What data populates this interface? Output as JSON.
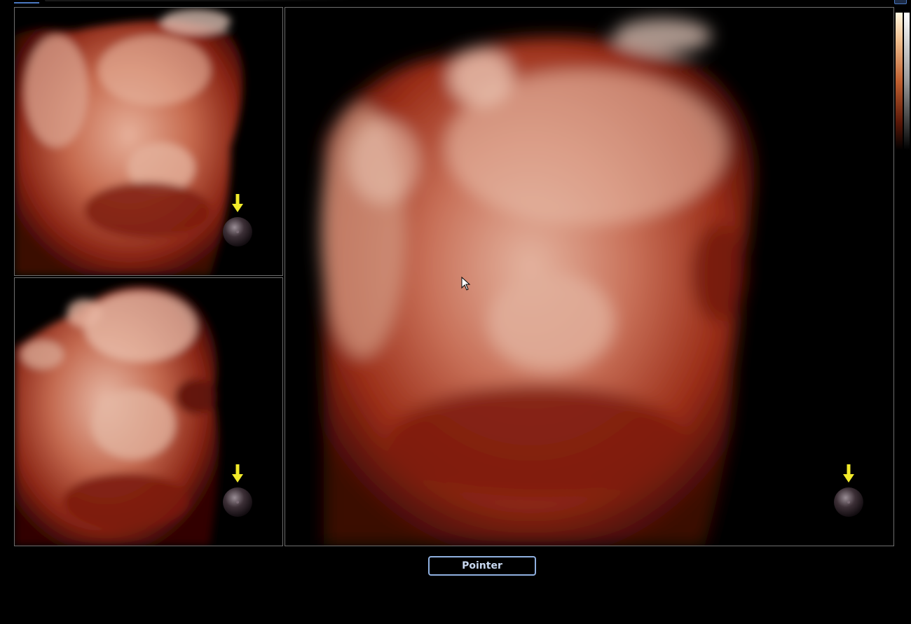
{
  "toolbar": {
    "mode_button_label": "Pointer"
  },
  "viewports": [
    {
      "id": "small-top",
      "icon": "orientation-ball-icon"
    },
    {
      "id": "small-bottom",
      "icon": "orientation-ball-icon"
    },
    {
      "id": "main",
      "icon": "orientation-ball-icon"
    }
  ],
  "colors": {
    "background": "#000000",
    "frame": "#6e6e6e",
    "button_border": "#8fb0e0",
    "button_text": "#c8d8f0",
    "orientation_arrow": "#f2ea2a",
    "tissue_dark": "#5a0c06",
    "tissue_mid": "#a83a22",
    "tissue_light": "#e6b09a"
  },
  "icons": {
    "cursor": "mouse-cursor-icon",
    "orientation": "orientation-ball-icon",
    "arrow": "down-arrow-icon"
  }
}
